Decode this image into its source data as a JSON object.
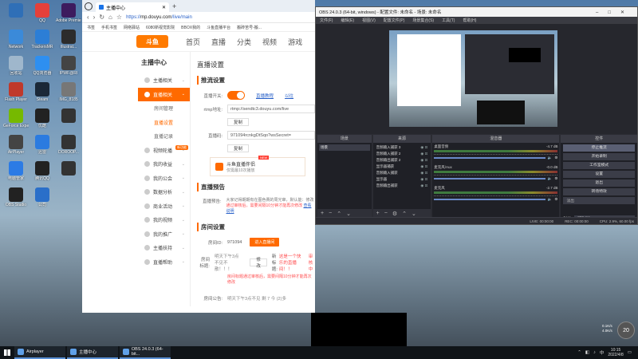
{
  "desktop": {
    "icons": [
      {
        "label": "",
        "color": "#2f6fb7"
      },
      {
        "label": "QQ",
        "color": "#e5403a"
      },
      {
        "label": "Adobe Premiere",
        "color": "#3d1b5e"
      },
      {
        "label": "Network",
        "color": "#3b8ad9"
      },
      {
        "label": "TrackersMR",
        "color": "#2c7ed6"
      },
      {
        "label": "Illustrat...",
        "color": "#2c2c2c"
      },
      {
        "label": "回收站",
        "color": "#9fb7cc"
      },
      {
        "label": "QQ浏览器",
        "color": "#2e8ff0"
      },
      {
        "label": "IPWF@RI",
        "color": "#444"
      },
      {
        "label": "Flash Player",
        "color": "#c0392b"
      },
      {
        "label": "Steam",
        "color": "#1b2838"
      },
      {
        "label": "IMG_8185",
        "color": "#777"
      },
      {
        "label": "GeForce Experience",
        "color": "#76b900"
      },
      {
        "label": "优酷",
        "color": "#222"
      },
      {
        "label": "",
        "color": "#333"
      },
      {
        "label": "AirPlayer",
        "color": "#444"
      },
      {
        "label": "迅雷",
        "color": "#2b7be0"
      },
      {
        "label": "DOROOP...",
        "color": "#333"
      },
      {
        "label": "电脑管家",
        "color": "#2c7be5"
      },
      {
        "label": "腾讯QQ",
        "color": "#222"
      },
      {
        "label": "",
        "color": "#333"
      },
      {
        "label": "OBS Studio",
        "color": "#222"
      },
      {
        "label": "公司",
        "color": "#2a6fc9"
      }
    ]
  },
  "browser": {
    "tab_title": "主播中心",
    "url_scheme": "https://",
    "url_host": "mp.douyu.com",
    "url_path": "/live/main",
    "bookmarks": [
      "书签",
      "手机书签",
      "网络驿站",
      "6080新视觉影院",
      "BBOX我的",
      "斗鱼直播平台",
      "搬砖苦号-搬..."
    ],
    "site_logo": "斗鱼",
    "nav": [
      "首页",
      "直播",
      "分类",
      "视频",
      "游戏"
    ],
    "sidebar": {
      "title": "主播中心",
      "items": [
        {
          "label": "主播相关",
          "type": "group"
        },
        {
          "label": "直播相关",
          "type": "group",
          "active": true
        },
        {
          "label": "房间管理",
          "type": "sub"
        },
        {
          "label": "直播设置",
          "type": "sub",
          "current": true
        },
        {
          "label": "直播记录",
          "type": "sub"
        },
        {
          "label": "视频轮播",
          "type": "group",
          "badge": "新功能"
        },
        {
          "label": "我的收益",
          "type": "group"
        },
        {
          "label": "我的公会",
          "type": "group"
        },
        {
          "label": "数据分析",
          "type": "group"
        },
        {
          "label": "商业活动",
          "type": "group"
        },
        {
          "label": "我的视频",
          "type": "group"
        },
        {
          "label": "我的推广",
          "type": "group"
        },
        {
          "label": "主播扶持",
          "type": "group"
        },
        {
          "label": "直播帮助",
          "type": "group"
        }
      ]
    },
    "main": {
      "title": "直播设置",
      "stream_section": "推流设置",
      "live_switch_label": "直播开关:",
      "link1": "直播教程",
      "link2": "以往",
      "rtmp_label": "rtmp地址:",
      "rtmp_value": "rtmp://sendtc3.douyu.com/live",
      "copy_btn": "复制",
      "code_label": "直播码:",
      "code_value": "971094rcnkgDtSqo?wsSecret=",
      "copy_btn2": "复制",
      "promo_title": "斗鱼直播伴侣",
      "promo_sub": "仅需最10次播放",
      "promo_new": "NEW",
      "promo_side": "房这",
      "notice_section": "直播预告",
      "notice_label": "直播预告:",
      "notice_desc": "大家记得期期有在图色赛的周光审，默认能：修改",
      "notice_warn": "通过审核后，需要间隔10分钟才能再次修改",
      "notice_link": "查看说明",
      "room_section": "房间设置",
      "room_id_label": "房间ID:",
      "room_id_value": "971094",
      "room_id_btn": "进入直播间",
      "room_title_label": "房间标题:",
      "room_title_value": "明天下午3点不见不散！！！",
      "room_title_btn": "修改",
      "new_title_label": "新标题:",
      "new_title_value": "这是一个快乐的直播间！！",
      "new_title_status": "审核中",
      "room_title_warn": "房间标题通过审核后，需要间隔10分钟才能再次修改",
      "announce_label": "房间公告:",
      "announce_value": "明天下午3点不见 剩 7 今 (2)多"
    }
  },
  "obs": {
    "title": "OBS 24.0.3 (64-bit, windows) - 配置文件: 未命名 - 场景: 未命名",
    "menu": [
      "文件(F)",
      "编辑(E)",
      "视图(V)",
      "配置文件(P)",
      "场景集合(S)",
      "工具(T)",
      "帮助(H)"
    ],
    "docks": {
      "scenes_title": "场景",
      "scenes": [
        "场景"
      ],
      "sources_title": "来源",
      "sources": [
        "音频输入捕获 3",
        "音频输入捕获 2",
        "音频输出捕获 2",
        "显示器捕获",
        "音频输入捕获",
        "显示器",
        "音频输出捕获"
      ],
      "mixer_title": "混音器",
      "mixer": [
        {
          "name": "桌面音频",
          "db": "-4.7 dB"
        },
        {
          "name": "麦克风/Aux",
          "db": "-0.0 dB"
        },
        {
          "name": "麦克风",
          "db": "-2.7 dB"
        }
      ],
      "controls_title": "控件",
      "controls": [
        "停止推流",
        "开始录制",
        "工作室模式",
        "设置",
        "退出"
      ],
      "transition_title": "转场特效",
      "transition_value": "淡出",
      "duration_label": "时长",
      "duration_value": "300 ms"
    },
    "status": {
      "live": "LIVE: 00:00:00",
      "rec": "REC: 00:00:00",
      "cpu": "CPU: 2.9%, 60.00 fps"
    }
  },
  "overlay": {
    "net_up": "0.1K/s",
    "net_down": "4.0K/s",
    "circle": "20"
  },
  "taskbar": {
    "items": [
      "Airplayer",
      "主播中心",
      "OBS 24.0.3 (64-bit..."
    ],
    "tray_lang": "中",
    "time": "10:15",
    "date": "2022/4/8"
  }
}
